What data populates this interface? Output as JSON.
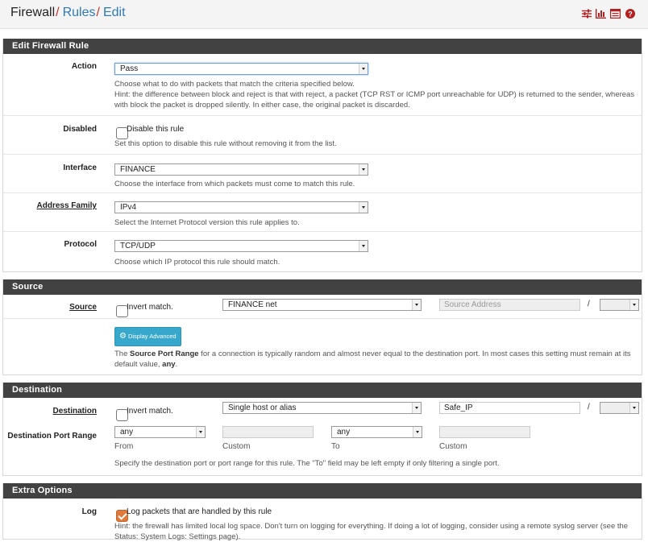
{
  "breadcrumb": {
    "root": "Firewall",
    "section": "Rules",
    "page": "Edit"
  },
  "header_icons": [
    "sliders-icon",
    "bar-chart-icon",
    "list-icon",
    "help-icon"
  ],
  "colors": {
    "header_bar": "#424242",
    "link": "#2f7ab6",
    "icon_red": "#b52020",
    "checkbox_checked": "#e07a3a",
    "button_info": "#37a8cb"
  },
  "edit_rule": {
    "title": "Edit Firewall Rule",
    "action": {
      "label": "Action",
      "value": "Pass",
      "help": "Choose what to do with packets that match the criteria specified below.",
      "hint": "Hint: the difference between block and reject is that with reject, a packet (TCP RST or ICMP port unreachable for UDP) is returned to the sender, whereas with block the packet is dropped silently. In either case, the original packet is discarded."
    },
    "disabled": {
      "label": "Disabled",
      "checkbox_label": "Disable this rule",
      "checked": false,
      "help": "Set this option to disable this rule without removing it from the list."
    },
    "interface": {
      "label": "Interface",
      "value": "FINANCE",
      "help": "Choose the interface from which packets must come to match this rule."
    },
    "address_family": {
      "label": "Address Family",
      "value": "IPv4",
      "help": "Select the Internet Protocol version this rule applies to."
    },
    "protocol": {
      "label": "Protocol",
      "value": "TCP/UDP",
      "help": "Choose which IP protocol this rule should match."
    }
  },
  "source": {
    "title": "Source",
    "label": "Source",
    "invert_label": "Invert match.",
    "invert_checked": false,
    "type": "FINANCE net",
    "address_placeholder": "Source Address",
    "slash": "/",
    "display_advanced": "Display Advanced",
    "help_prefix": "The ",
    "help_bold": "Source Port Range",
    "help_middle": " for a connection is typically random and almost never equal to the destination port. In most cases this setting must remain at its default value, ",
    "help_bold2": "any",
    "help_suffix": "."
  },
  "destination": {
    "title": "Destination",
    "label": "Destination",
    "invert_label": "Invert match.",
    "invert_checked": false,
    "type": "Single host or alias",
    "address": "Safe_IP",
    "slash": "/",
    "port_range_label": "Destination Port Range",
    "from_value": "any",
    "from_label": "From",
    "from_custom_label": "Custom",
    "to_value": "any",
    "to_label": "To",
    "to_custom_label": "Custom",
    "help": "Specify the destination port or port range for this rule. The \"To\" field may be left empty if only filtering a single port."
  },
  "extra": {
    "title": "Extra Options",
    "log": {
      "label": "Log",
      "checkbox_label": "Log packets that are handled by this rule",
      "checked": true
    },
    "hint": "Hint: the firewall has limited local log space. Don't turn on logging for everything. If doing a lot of logging, consider using a remote syslog server (see the Status: System Logs: Settings page)."
  }
}
